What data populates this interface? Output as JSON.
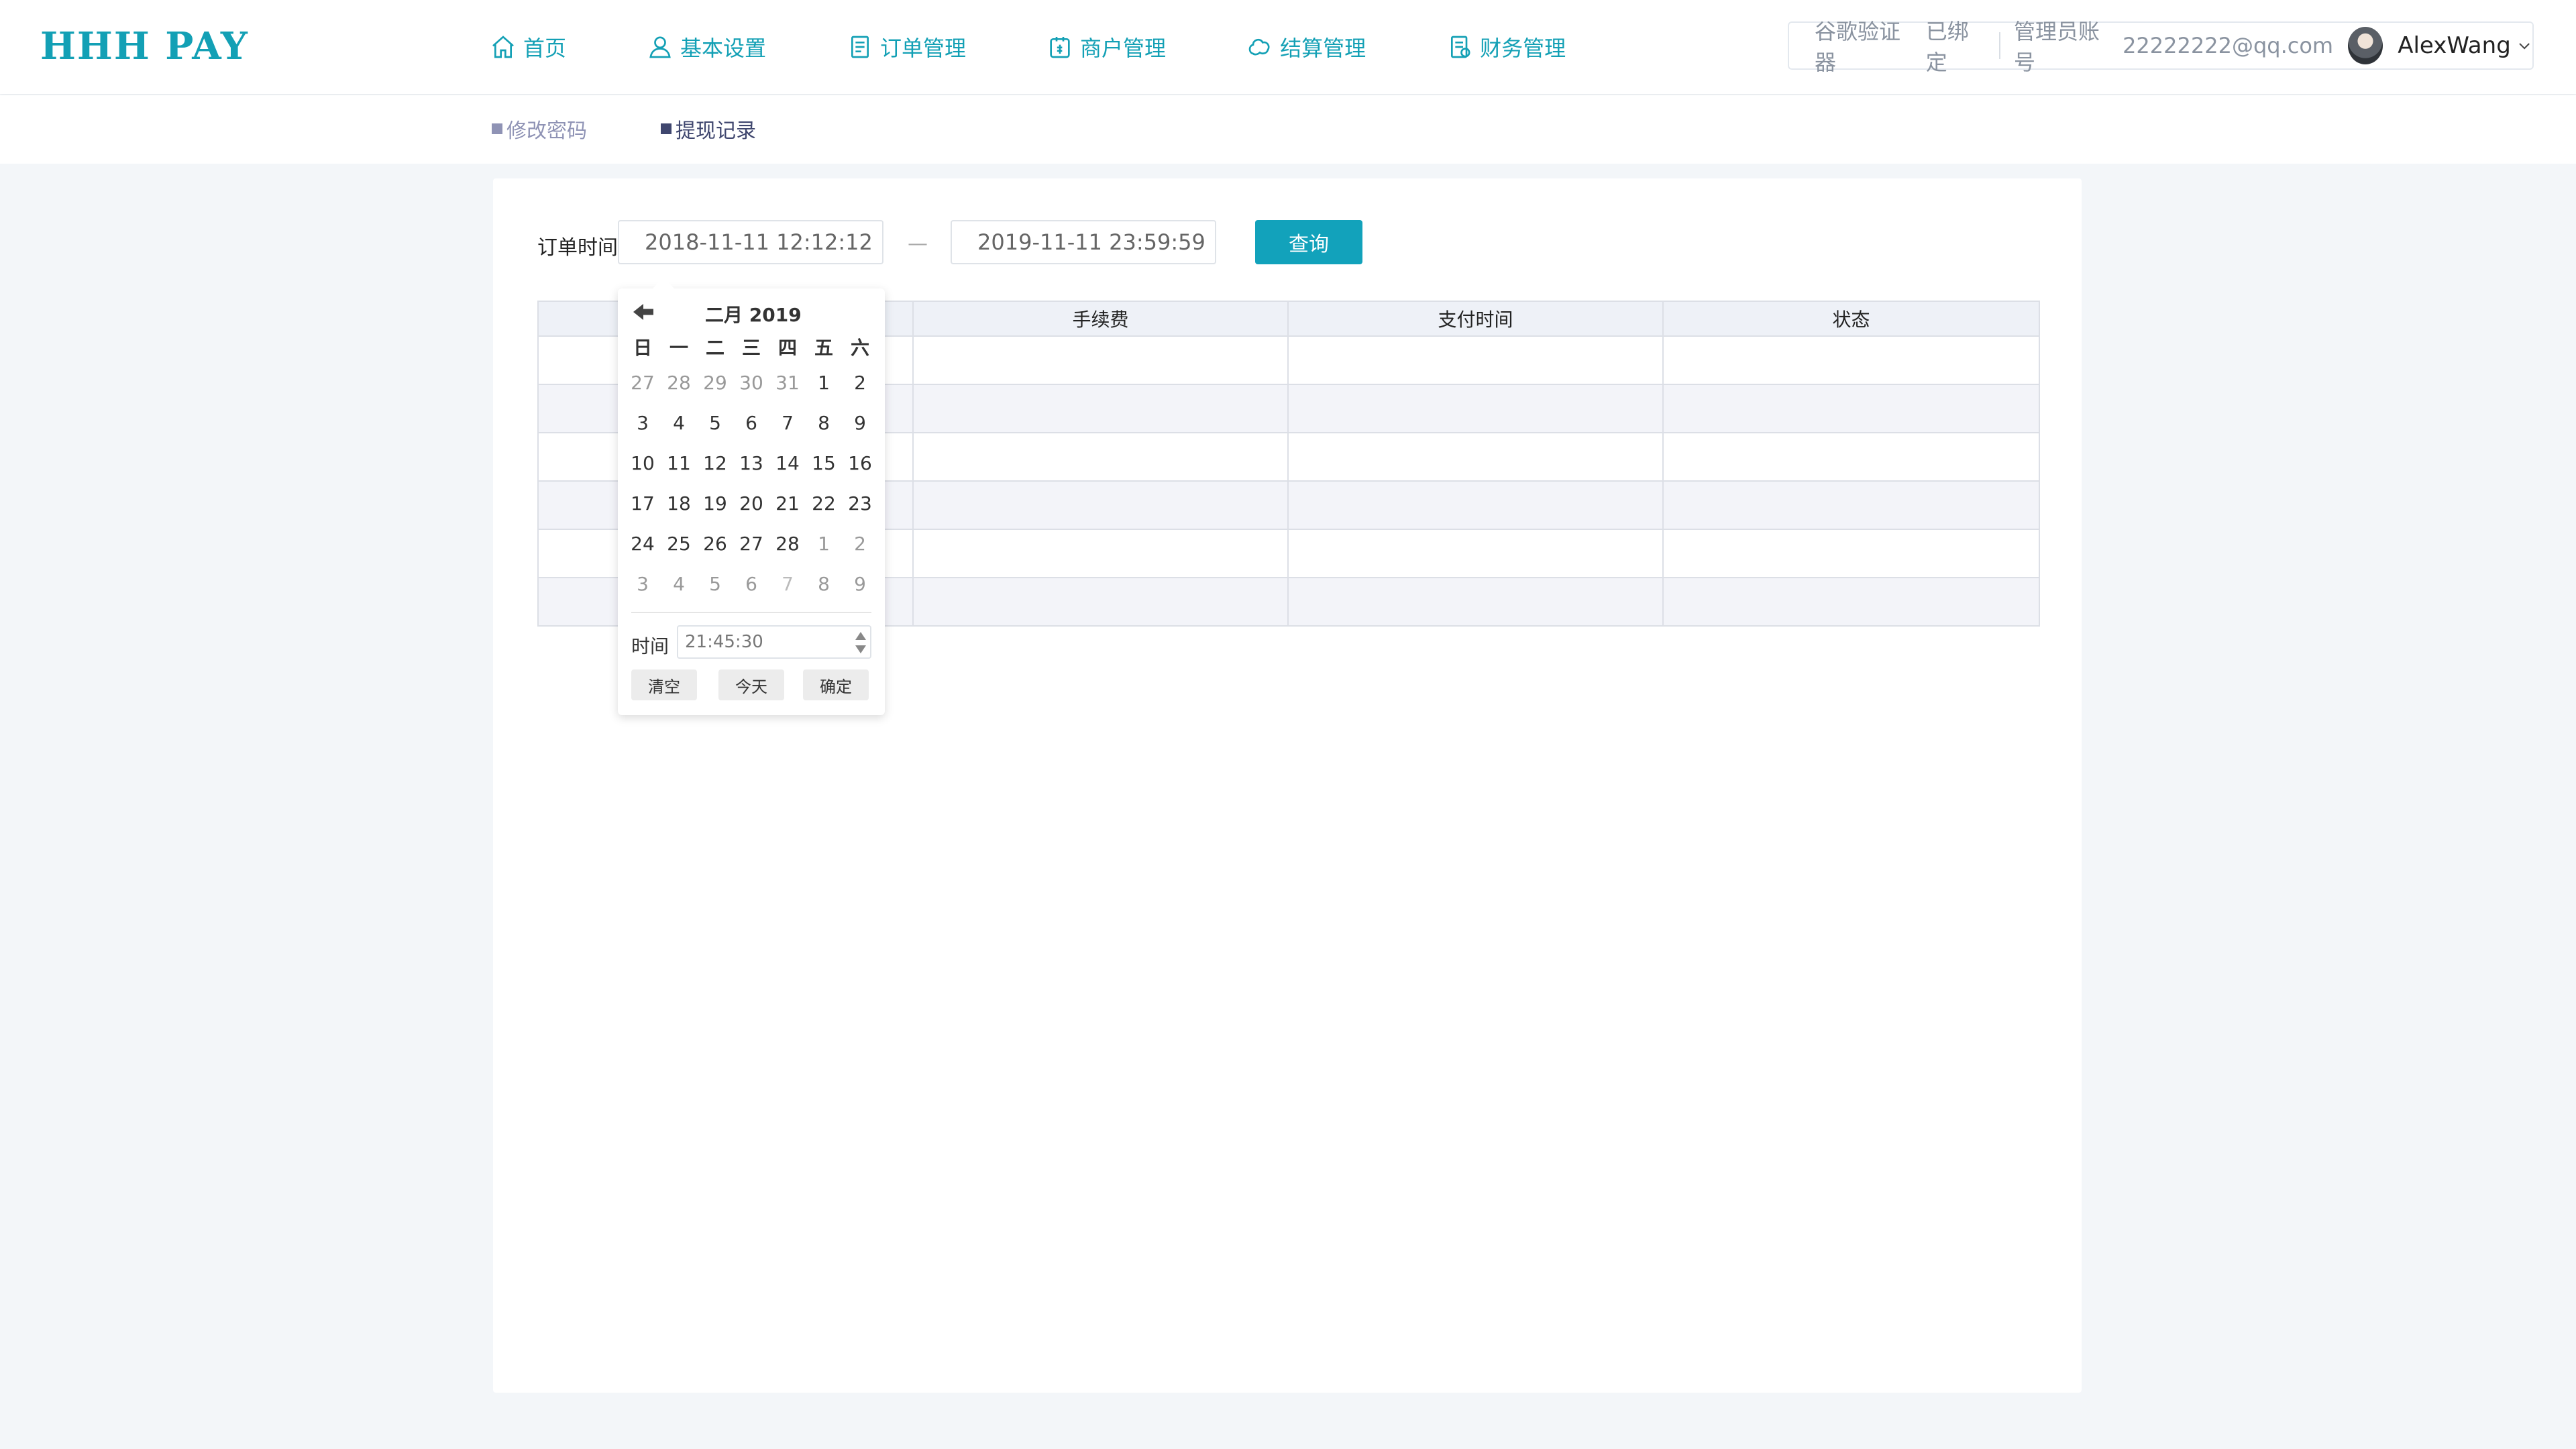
{
  "colors": {
    "brand": "#13a0b5",
    "button": "#12a2bb",
    "subnav_inactive": "#8f93b5",
    "subnav_active": "#3f466e"
  },
  "header": {
    "logo": "HHH PAY",
    "nav": [
      {
        "label": "首页",
        "icon": "home-icon"
      },
      {
        "label": "基本设置",
        "icon": "user-icon"
      },
      {
        "label": "订单管理",
        "icon": "document-icon"
      },
      {
        "label": "商户管理",
        "icon": "merchant-icon"
      },
      {
        "label": "结算管理",
        "icon": "settlement-icon"
      },
      {
        "label": "财务管理",
        "icon": "finance-icon"
      }
    ],
    "user": {
      "google_auth": "谷歌验证器",
      "google_status": "已绑定",
      "admin_label": "管理员账号",
      "admin_email": "22222222@qq.com",
      "name": "AlexWang",
      "dropdown_icon": "chevron-down-icon"
    }
  },
  "subnav": {
    "items": [
      {
        "label": "修改密码",
        "active": false
      },
      {
        "label": "提现记录",
        "active": true
      }
    ]
  },
  "filter": {
    "label": "订单时间",
    "start": "2018-11-11 12:12:12",
    "separator": "—",
    "end": "2019-11-11 23:59:59",
    "query_button": "查询"
  },
  "table": {
    "columns": [
      "",
      "手续费",
      "支付时间",
      "状态"
    ],
    "row_count": 6
  },
  "calendar": {
    "title": "二月 2019",
    "back_icon": "arrow-left-icon",
    "weekdays": [
      "日",
      "一",
      "二",
      "三",
      "四",
      "五",
      "六"
    ],
    "weeks": [
      [
        "27",
        "28",
        "29",
        "30",
        "31",
        "1",
        "2"
      ],
      [
        "3",
        "4",
        "5",
        "6",
        "7",
        "8",
        "9"
      ],
      [
        "10",
        "11",
        "12",
        "13",
        "14",
        "15",
        "16"
      ],
      [
        "17",
        "18",
        "19",
        "20",
        "21",
        "22",
        "23"
      ],
      [
        "24",
        "25",
        "26",
        "27",
        "28",
        "1",
        "2"
      ],
      [
        "3",
        "4",
        "5",
        "6",
        "7",
        "8",
        "9"
      ]
    ],
    "time_label": "时间",
    "time_value": "21:45:30",
    "buttons": {
      "clear": "清空",
      "today": "今天",
      "confirm": "确定"
    }
  }
}
